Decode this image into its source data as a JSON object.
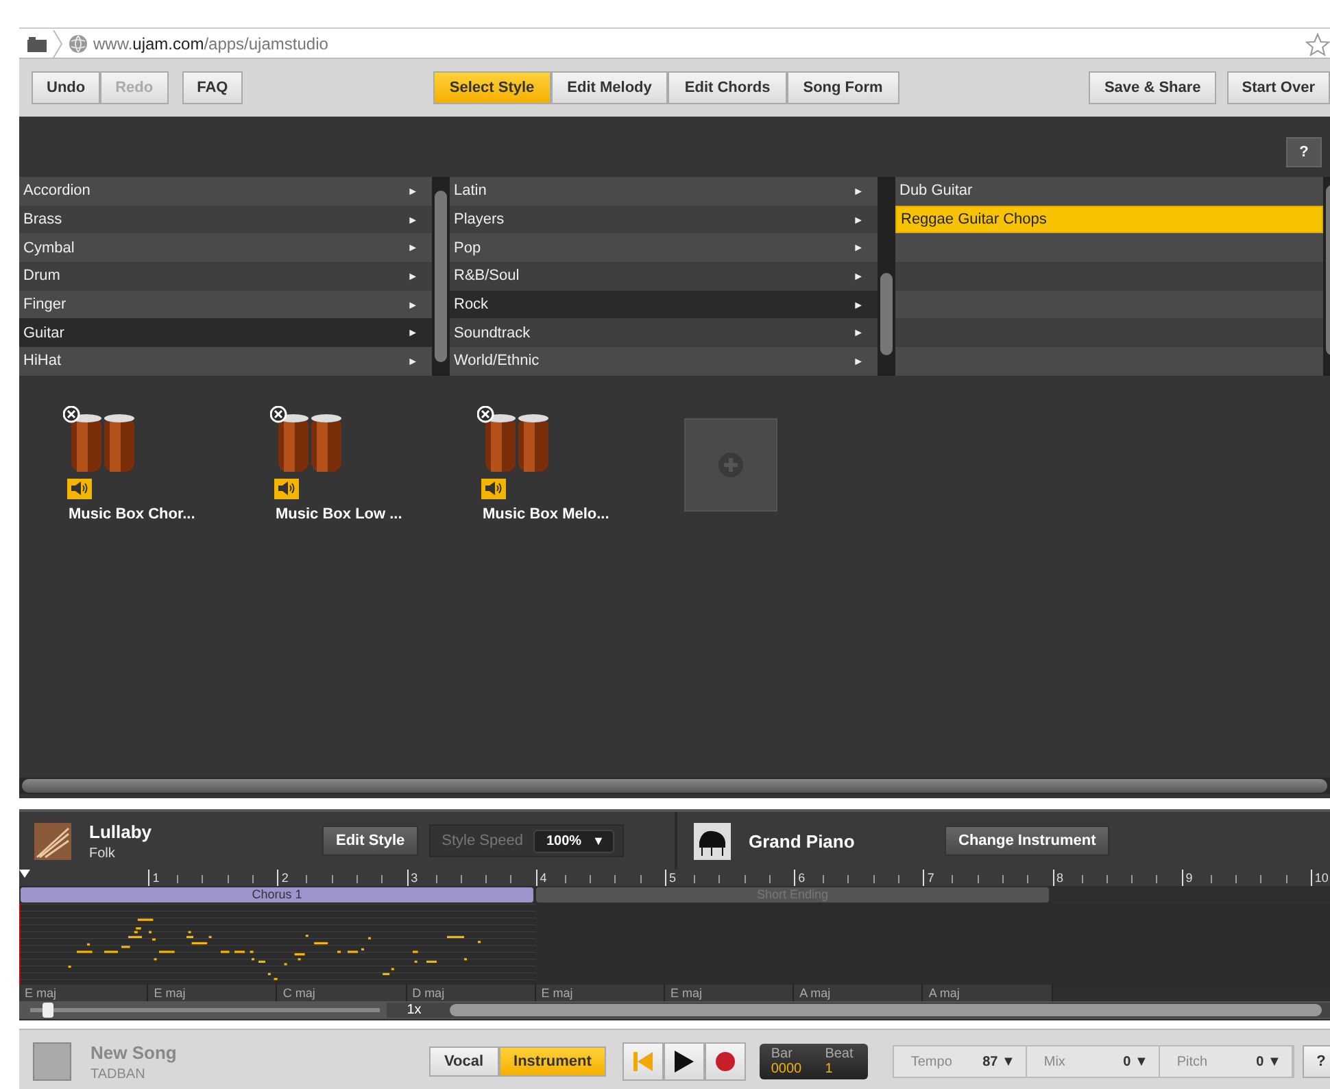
{
  "browser": {
    "url": "www.**ujam.com**/apps/ujamstudio"
  },
  "toolbar": {
    "left": [
      {
        "label": "Undo",
        "disabled": false
      },
      {
        "label": "Redo",
        "disabled": true
      },
      {
        "label": "FAQ",
        "disabled": false
      }
    ],
    "tabs": [
      {
        "label": "Select Style",
        "selected": true
      },
      {
        "label": "Edit Melody",
        "selected": false
      },
      {
        "label": "Edit Chords",
        "selected": false
      },
      {
        "label": "Song Form",
        "selected": false
      }
    ],
    "right": [
      "Save & Share",
      "Start Over"
    ]
  },
  "help_button": "?",
  "browser_columns": [
    {
      "arrow": "►",
      "items": [
        {
          "label": "Accordion",
          "selected": false
        },
        {
          "label": "Brass",
          "selected": false
        },
        {
          "label": "Cymbal",
          "selected": false
        },
        {
          "label": "Drum",
          "selected": false
        },
        {
          "label": "Finger",
          "selected": false
        },
        {
          "label": "Guitar",
          "selected": true
        },
        {
          "label": "HiHat",
          "selected": false
        }
      ]
    },
    {
      "arrow": "►",
      "items": [
        {
          "label": "Latin",
          "selected": false
        },
        {
          "label": "Players",
          "selected": false
        },
        {
          "label": "Pop",
          "selected": false
        },
        {
          "label": "R&B/Soul",
          "selected": false
        },
        {
          "label": "Rock",
          "selected": true
        },
        {
          "label": "Soundtrack",
          "selected": false
        },
        {
          "label": "World/Ethnic",
          "selected": false
        }
      ]
    },
    {
      "items": [
        {
          "label": "Dub Guitar",
          "selected": false
        },
        {
          "label": "Reggae Guitar Chops",
          "selected": true
        }
      ]
    }
  ],
  "instruments": [
    {
      "label": "Music Box Chor..."
    },
    {
      "label": "Music Box Low ..."
    },
    {
      "label": "Music Box Melo..."
    }
  ],
  "track": {
    "style_title": "Lullaby",
    "style_genre": "Folk",
    "edit_style": "Edit Style",
    "speed_label": "Style Speed",
    "speed_value": "100%",
    "speed_caret": "▼",
    "instrument": "Grand Piano",
    "change_instrument": "Change Instrument"
  },
  "timeline": {
    "bars": [
      "1",
      "2",
      "3",
      "4",
      "5",
      "6",
      "7",
      "8",
      "9",
      "10"
    ],
    "sections": [
      {
        "label": "Chorus 1",
        "kind": "chorus"
      },
      {
        "label": "Short Ending",
        "kind": "ending"
      }
    ],
    "chords": [
      "E maj",
      "E maj",
      "C maj",
      "D maj",
      "E maj",
      "E maj",
      "A maj",
      "A maj"
    ],
    "zoom": {
      "level": 0.05,
      "label": "1x"
    }
  },
  "song": {
    "title": "New Song",
    "artist": "TADBAN"
  },
  "mode": [
    {
      "label": "Vocal",
      "selected": false
    },
    {
      "label": "Instrument",
      "selected": true
    }
  ],
  "position": {
    "bar_label": "Bar",
    "beat_label": "Beat",
    "bar": "0000",
    "beat": "1"
  },
  "controls": [
    {
      "label": "Tempo",
      "value": "87",
      "caret": "▼"
    },
    {
      "label": "Mix",
      "value": "0",
      "caret": "▼"
    },
    {
      "label": "Pitch",
      "value": "0",
      "caret": "▼"
    }
  ],
  "bottom_help": "?"
}
